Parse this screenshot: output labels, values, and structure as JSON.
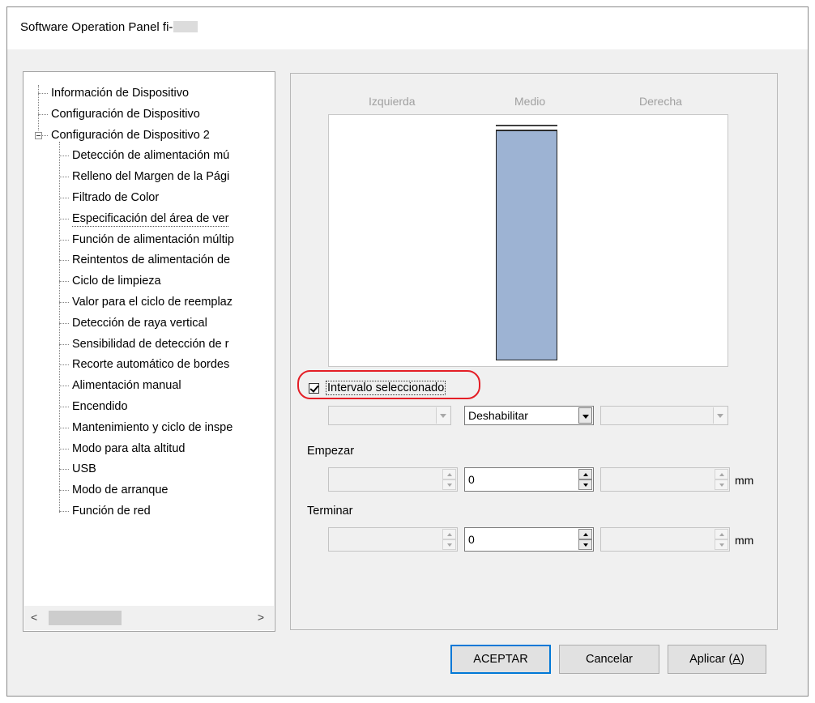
{
  "window": {
    "title": "Software Operation Panel fi-"
  },
  "tree": {
    "items": [
      {
        "label": "Información de Dispositivo",
        "level": 0
      },
      {
        "label": "Configuración de Dispositivo",
        "level": 0
      },
      {
        "label": "Configuración de Dispositivo 2",
        "level": 0,
        "expanded": true
      },
      {
        "label": "Detección de alimentación mú",
        "level": 1
      },
      {
        "label": "Relleno del Margen de la Pági",
        "level": 1
      },
      {
        "label": "Filtrado de Color",
        "level": 1
      },
      {
        "label": "Especificación del área de ver",
        "level": 1,
        "selected": true
      },
      {
        "label": "Función de alimentación múltip",
        "level": 1
      },
      {
        "label": "Reintentos de alimentación de",
        "level": 1
      },
      {
        "label": "Ciclo de limpieza",
        "level": 1
      },
      {
        "label": "Valor para el ciclo de reemplaz",
        "level": 1
      },
      {
        "label": "Detección de raya vertical",
        "level": 1
      },
      {
        "label": "Sensibilidad de detección de r",
        "level": 1
      },
      {
        "label": "Recorte automático de bordes",
        "level": 1
      },
      {
        "label": "Alimentación manual",
        "level": 1
      },
      {
        "label": "Encendido",
        "level": 1
      },
      {
        "label": "Mantenimiento y ciclo de inspe",
        "level": 1
      },
      {
        "label": "Modo para alta altitud",
        "level": 1
      },
      {
        "label": "USB",
        "level": 1
      },
      {
        "label": "Modo de arranque",
        "level": 1
      },
      {
        "label": "Función de red",
        "level": 1
      }
    ],
    "scroll_left": "<",
    "scroll_right": ">"
  },
  "panel": {
    "columns": {
      "left": "Izquierda",
      "middle": "Medio",
      "right": "Derecha"
    },
    "checkbox": {
      "label": "Intervalo seleccionado",
      "checked": true
    },
    "mode_selects": {
      "left": "",
      "middle": "Deshabilitar",
      "right": ""
    },
    "start": {
      "label": "Empezar",
      "left": "",
      "middle": "0",
      "right": "",
      "unit": "mm"
    },
    "end": {
      "label": "Terminar",
      "left": "",
      "middle": "0",
      "right": "",
      "unit": "mm"
    }
  },
  "buttons": {
    "ok": "ACEPTAR",
    "cancel": "Cancelar",
    "apply_prefix": "Aplicar (",
    "apply_key": "A",
    "apply_suffix": ")"
  },
  "colors": {
    "highlight": "#e41e26",
    "bar_fill": "#9db3d3"
  }
}
